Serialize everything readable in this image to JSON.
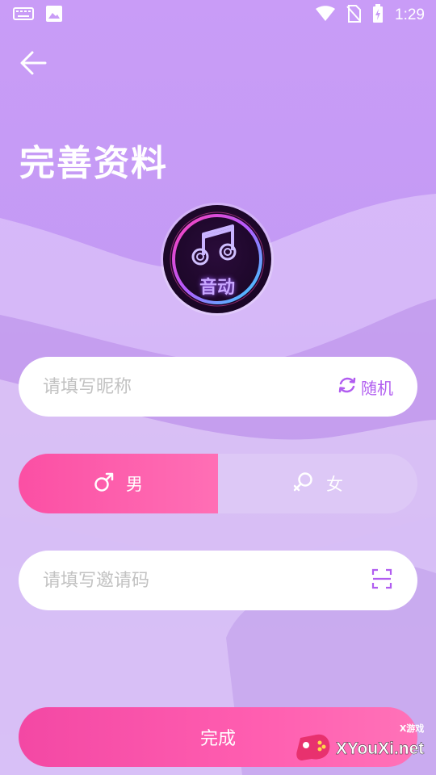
{
  "status_bar": {
    "time": "1:29",
    "left_icons": [
      "keyboard-icon",
      "image-icon"
    ],
    "right_icons": [
      "wifi-icon",
      "no-sim-icon",
      "battery-charging-icon"
    ]
  },
  "header": {
    "title": "完善资料"
  },
  "logo": {
    "text": "音动"
  },
  "form": {
    "nickname_placeholder": "请填写昵称",
    "random_label": "随机",
    "gender_male_label": "男",
    "gender_female_label": "女",
    "selected_gender": "male",
    "invite_placeholder": "请填写邀请码",
    "submit_label": "完成"
  },
  "watermark": {
    "text": "XYouXi.net",
    "small_text": "X游戏"
  },
  "colors": {
    "accent_pink": "#fb4fa4",
    "accent_purple": "#b15df0",
    "background": "#c99cf7"
  }
}
